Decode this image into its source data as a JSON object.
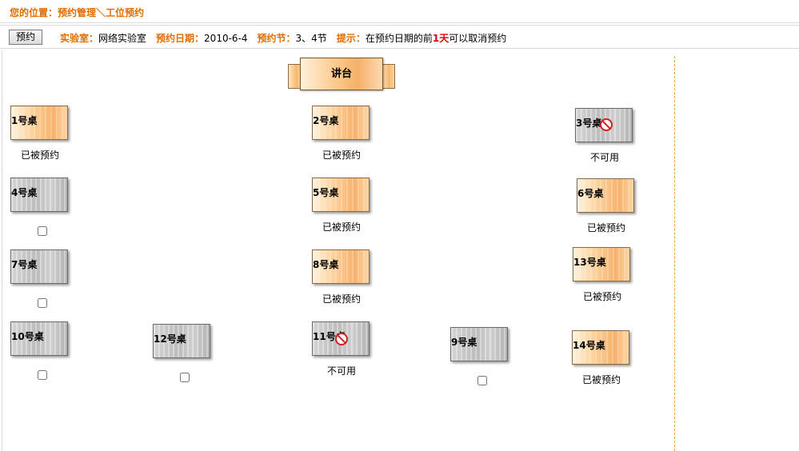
{
  "breadcrumb": "您的位置：预约管理＼工位预约",
  "toolbar": {
    "reserve_label": "预约"
  },
  "info": {
    "lab_label": "实验室：",
    "lab_value": "网络实验室",
    "date_label": "预约日期：",
    "date_value": "2010-6-4",
    "period_label": "预约节：",
    "period_value": "3、4节",
    "tip_label": "提示：",
    "tip_pre": "在预约日期的前",
    "tip_days": "1天",
    "tip_post": "可以取消预约"
  },
  "podium_label": "讲台",
  "desks": [
    {
      "label": "1号桌",
      "status": "已被预约"
    },
    {
      "label": "2号桌",
      "status": "已被预约"
    },
    {
      "label": "3号桌",
      "status": "不可用"
    },
    {
      "label": "4号桌",
      "status": ""
    },
    {
      "label": "5号桌",
      "status": "已被预约"
    },
    {
      "label": "6号桌",
      "status": "已被预约"
    },
    {
      "label": "7号桌",
      "status": ""
    },
    {
      "label": "8号桌",
      "status": "已被预约"
    },
    {
      "label": "13号桌",
      "status": "已被预约"
    },
    {
      "label": "10号桌",
      "status": ""
    },
    {
      "label": "12号桌",
      "status": ""
    },
    {
      "label": "11号桌",
      "status": "不可用"
    },
    {
      "label": "9号桌",
      "status": ""
    },
    {
      "label": "14号桌",
      "status": "已被预约"
    }
  ],
  "colors": {
    "accent": "#e06c00",
    "highlight": "#e00000",
    "divider": "#e8a040"
  }
}
